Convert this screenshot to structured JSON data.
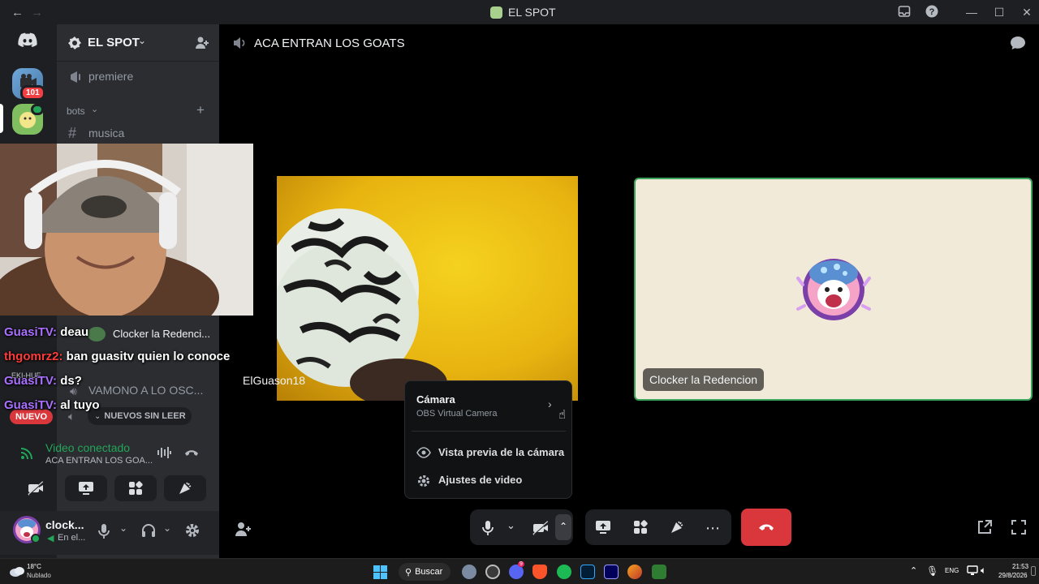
{
  "window": {
    "title": "EL SPOT",
    "back": "←",
    "forward": "→",
    "minimize": "—",
    "maximize": "☐",
    "close": "✕"
  },
  "rail": {
    "badge_count": "101"
  },
  "sidebar": {
    "server_name": "EL SPOT",
    "channels": [
      {
        "name": "premiere",
        "type": "stage"
      },
      {
        "category": "bots"
      },
      {
        "name": "musica",
        "type": "text"
      }
    ],
    "voice_channel_overlay": "VAMONO A LO OSC...",
    "new_label": "NUEVO",
    "unread_label": "NUEVOS SIN LEER",
    "voice_user_overlay": "Clocker la Redenci...",
    "small_label": "EKI-HUE"
  },
  "chat": [
    {
      "user": "GuasiTV:",
      "message": "deau",
      "color": "purple"
    },
    {
      "user": "thgomrz2:",
      "message": "ban guasitv quien lo conoce",
      "color": "red"
    },
    {
      "user": "GuasiTV:",
      "message": "ds?",
      "color": "purple"
    },
    {
      "user": "GuasiTV:",
      "message": "al tuyo",
      "color": "purple"
    }
  ],
  "header": {
    "channel_name": "ACA ENTRAN LOS GOATS"
  },
  "tiles": {
    "elguason_name": "ElGuason18",
    "clocker_name": "Clocker la Redencion"
  },
  "cam_menu": {
    "title": "Cámara",
    "subtitle": "OBS Virtual Camera",
    "preview": "Vista previa de la cámara",
    "settings": "Ajustes de video"
  },
  "voice_panel": {
    "status": "Video conectado",
    "channel": "ACA ENTRAN LOS GOA..."
  },
  "user_panel": {
    "name": "clock...",
    "status": "En el..."
  },
  "taskbar": {
    "weather_temp": "18°C",
    "weather_desc": "Nublado",
    "search": "Buscar",
    "lang": "ENG",
    "time": "21:53",
    "date": "29/8/2026",
    "discord_badge": "9"
  },
  "colors": {
    "accent_green": "#3ba55d",
    "hangup_red": "#da373c",
    "chat_purple": "#a970ff",
    "chat_red": "#ff3b3b"
  }
}
